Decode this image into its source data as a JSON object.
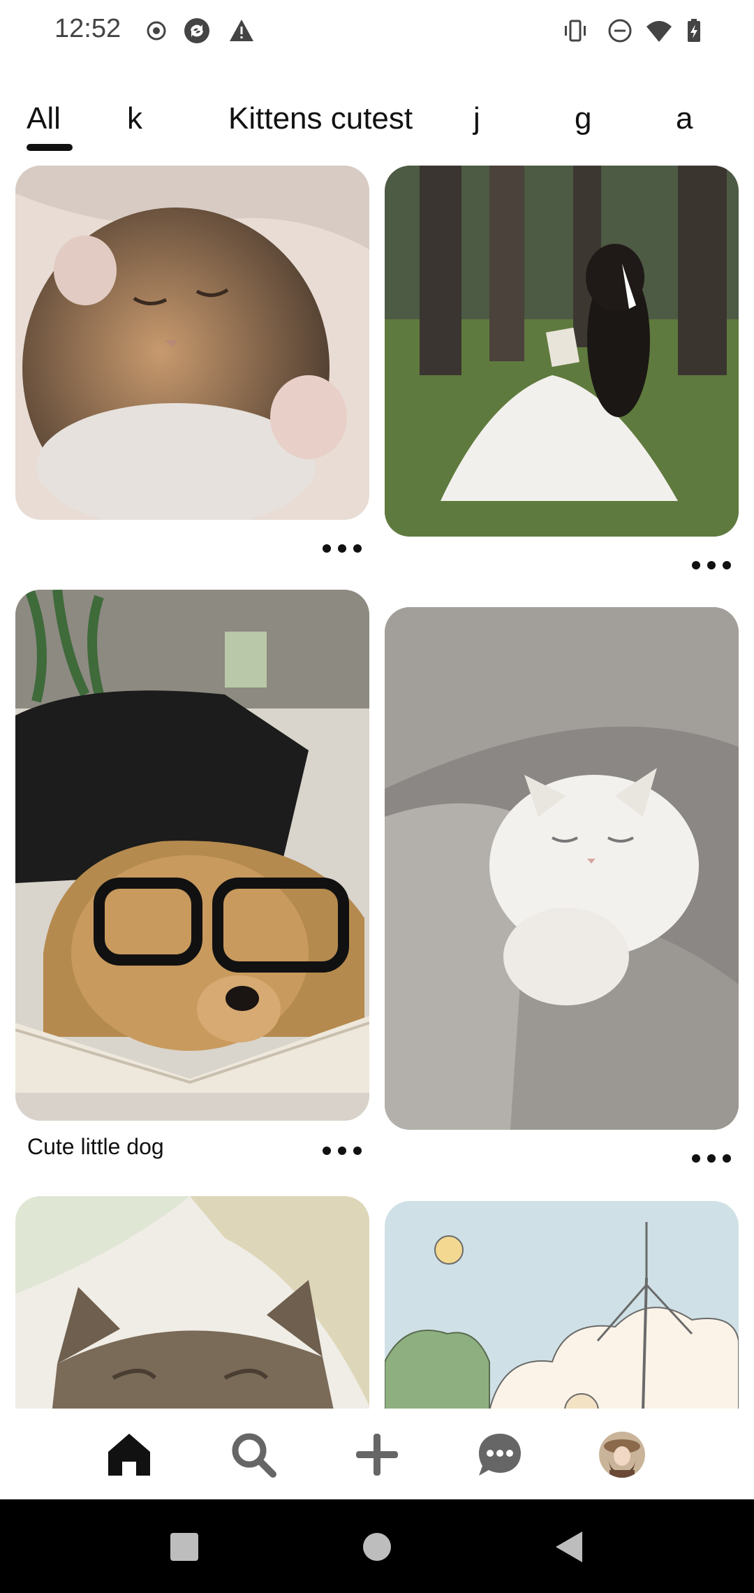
{
  "status_bar": {
    "time": "12:52",
    "left_icons": [
      "record-icon",
      "sync-icon",
      "warning-icon"
    ],
    "right_icons": [
      "vibrate-icon",
      "do-not-disturb-icon",
      "wifi-icon",
      "battery-icon"
    ]
  },
  "tabs": [
    {
      "label": "All",
      "selected": true
    },
    {
      "label": "k",
      "selected": false
    },
    {
      "label": "Kittens cutest",
      "selected": false
    },
    {
      "label": "j",
      "selected": false
    },
    {
      "label": "g",
      "selected": false
    },
    {
      "label": "a",
      "selected": false
    }
  ],
  "pins": [
    {
      "id": "kitten-sleeping",
      "title": ""
    },
    {
      "id": "girl-reading-forest",
      "title": ""
    },
    {
      "id": "dog-with-glasses",
      "title": "Cute little dog"
    },
    {
      "id": "white-cat-blanket",
      "title": ""
    },
    {
      "id": "tabby-cat-bed",
      "title": ""
    },
    {
      "id": "illustration-windmill",
      "title": ""
    }
  ],
  "bottom_nav": {
    "items": [
      "home-icon",
      "search-icon",
      "create-icon",
      "messages-icon",
      "profile-avatar"
    ],
    "active": "home-icon"
  },
  "system_nav": [
    "recents-icon",
    "home-circle-icon",
    "back-icon"
  ],
  "colors": {
    "text": "#111111",
    "background": "#ffffff",
    "system_bar": "#000000"
  }
}
